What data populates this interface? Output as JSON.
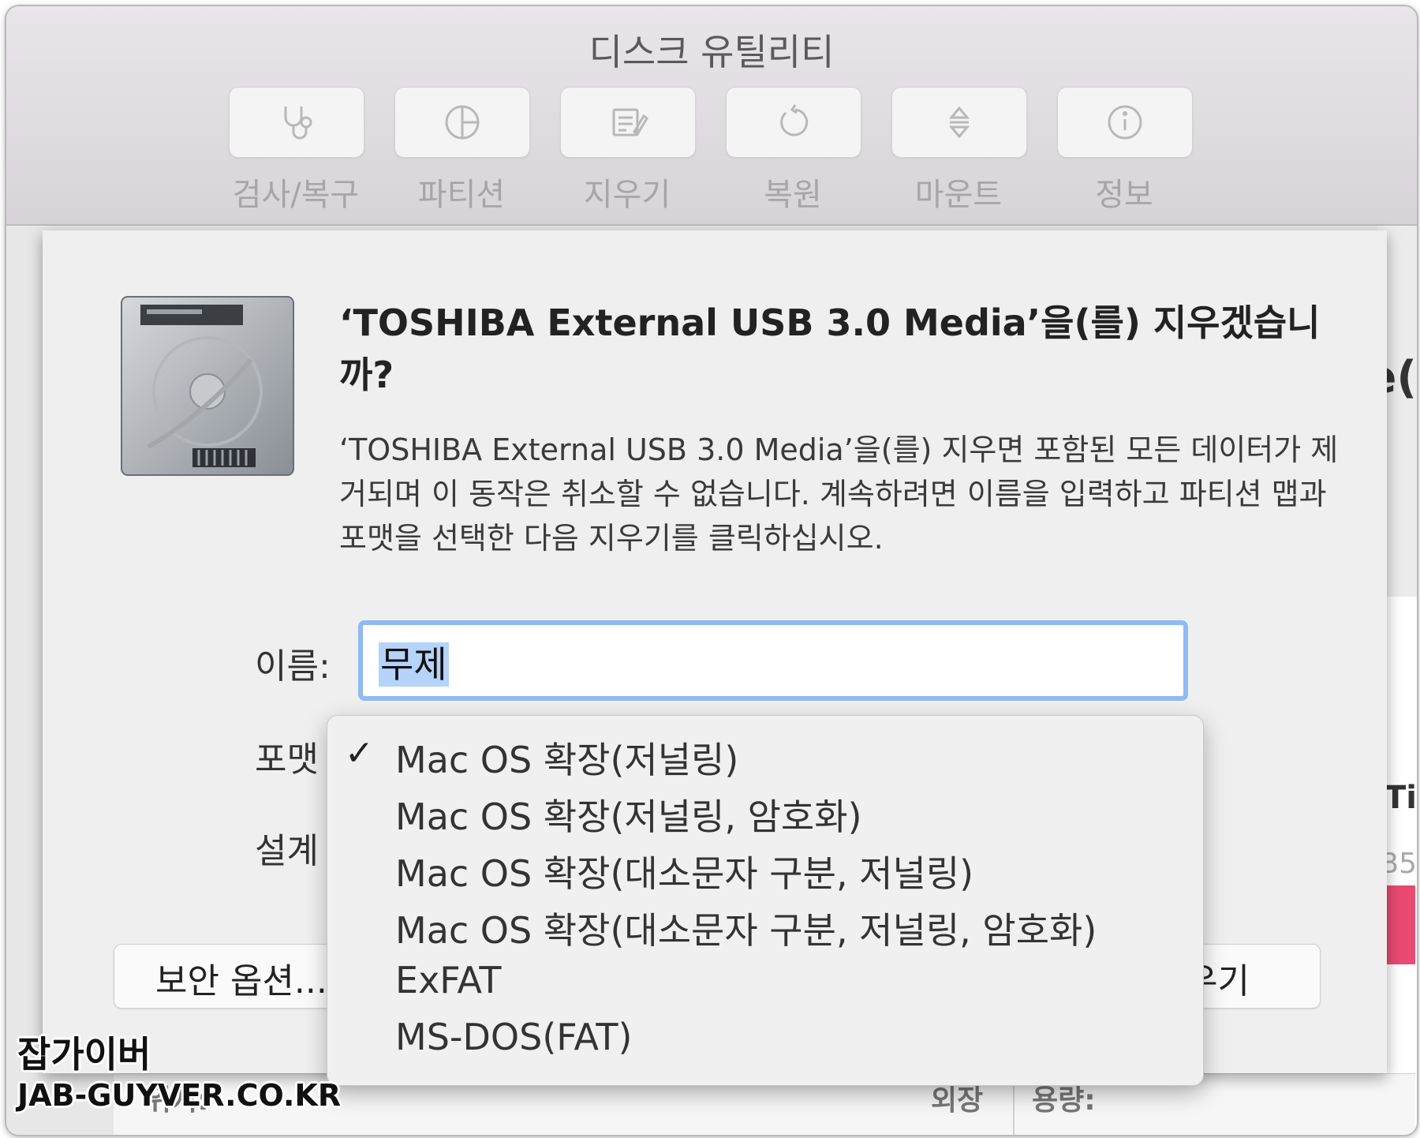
{
  "window": {
    "title": "디스크 유틸리티"
  },
  "toolbar": {
    "items": [
      {
        "label": "검사/복구",
        "icon": "stethoscope-icon"
      },
      {
        "label": "파티션",
        "icon": "pie-chart-icon"
      },
      {
        "label": "지우기",
        "icon": "eraser-icon"
      },
      {
        "label": "복원",
        "icon": "restore-icon"
      },
      {
        "label": "마운트",
        "icon": "mount-icon"
      },
      {
        "label": "정보",
        "icon": "info-icon"
      }
    ]
  },
  "dialog": {
    "heading": "‘TOSHIBA External USB 3.0 Media’을(를) 지우겠습니까?",
    "message": "‘TOSHIBA External USB 3.0 Media’을(를) 지우면 포함된 모든 데이터가 제거되며 이 동작은 취소할 수 없습니다. 계속하려면 이름을 입력하고 파티션 맵과 포맷을 선택한 다음 지우기를 클릭하십시오.",
    "name_label": "이름:",
    "name_value": "무제",
    "format_label": "포맷",
    "scheme_label": "설계",
    "security_button": "보안 옵션...",
    "erase_button": "우기"
  },
  "format_menu": {
    "selected_index": 0,
    "checkmark": "✓",
    "options": [
      "Mac OS 확장(저널링)",
      "Mac OS 확장(저널링, 암호화)",
      "Mac OS 확장(대소문자 구분, 저널링)",
      "Mac OS 확장(대소문자 구분, 저널링, 암호화)",
      "ExFAT",
      "MS-DOS(FAT)"
    ]
  },
  "background": {
    "fragment_1": "e(",
    "fragment_2": "Ti",
    "fragment_3": "B5",
    "bottom_left": "위치:",
    "bottom_mid": "외장",
    "bottom_right": "용량:"
  },
  "watermark": {
    "line1": "잡가이버",
    "line2": "JAB-GUYVER.CO.KR"
  },
  "colors": {
    "input_focus": "#8fbaf2",
    "selection": "#b5d3fb",
    "accent_pink": "#e94a72"
  }
}
